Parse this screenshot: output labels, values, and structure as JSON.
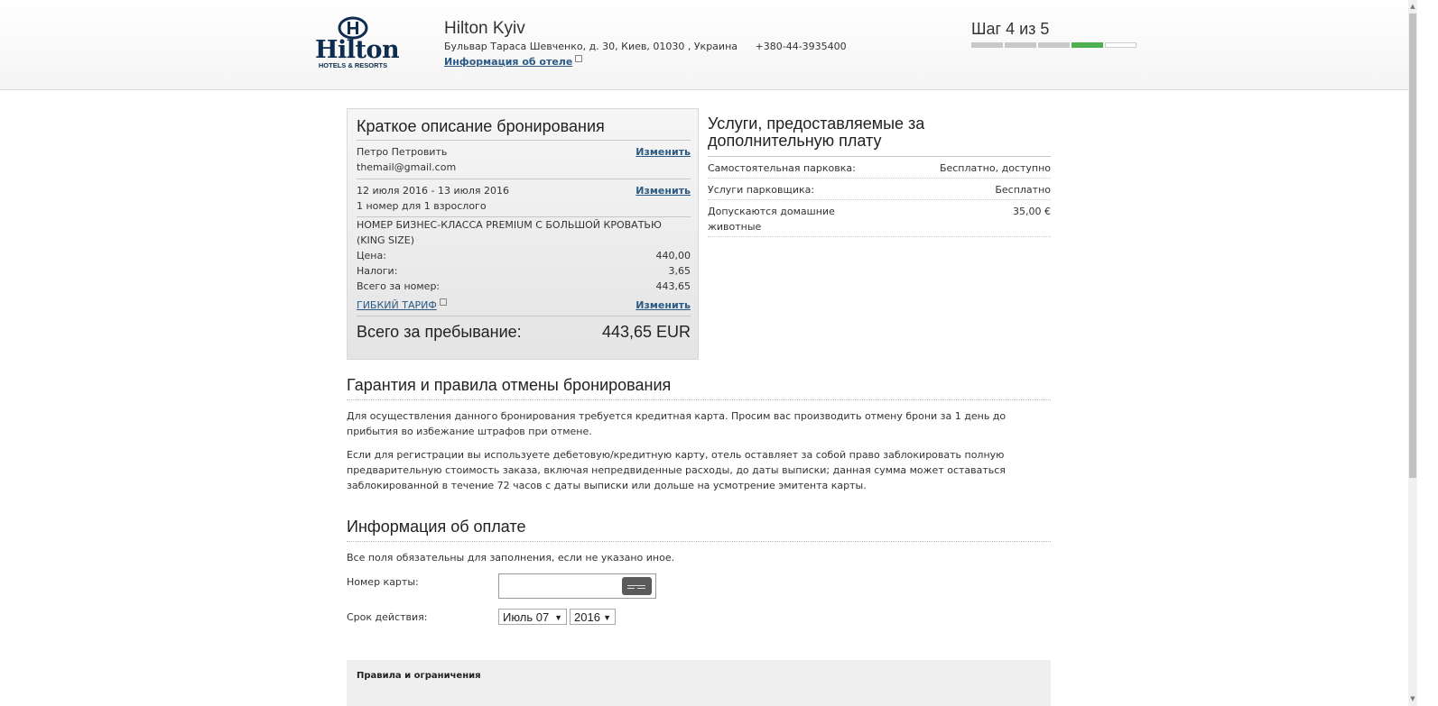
{
  "header": {
    "logo_name": "Hilton",
    "logo_sub": "HOTELS & RESORTS",
    "hotel_name": "Hilton Kyiv",
    "address": "Бульвар Тараса Шевченко, д. 30, Киев, 01030 , Украина",
    "phone": "+380-44-3935400",
    "hotel_info_link": "Информация об отеле",
    "step_label": "Шаг 4 из 5",
    "step_current": 4,
    "step_total": 5
  },
  "summary": {
    "title": "Краткое описание бронирования",
    "guest_name": "Петро Петровить",
    "guest_email": "themail@gmail.com",
    "dates": "12 июля 2016 - 13 июля 2016",
    "rooms": "1 номер для 1 взрослого",
    "room_type": "НОМЕР БИЗНЕС-КЛАССА PREMIUM С БОЛЬШОЙ КРОВАТЬЮ (KING SIZE)",
    "price_label": "Цена:",
    "price_value": "440,00",
    "taxes_label": "Налоги:",
    "taxes_value": "3,65",
    "room_total_label": "Всего за номер:",
    "room_total_value": "443,65",
    "tariff_link": "ГИБКИЙ ТАРИФ",
    "change_label": "Изменить",
    "stay_total_label": "Всего за пребывание:",
    "stay_total_value": "443,65 EUR"
  },
  "extras": {
    "title": "Услуги, предоставляемые за дополнительную плату",
    "items": [
      {
        "label": "Самостоятельная парковка:",
        "value": "Бесплатно, доступно"
      },
      {
        "label": "Услуги парковщика:",
        "value": "Бесплатно"
      },
      {
        "label": "Допускаются домашние животные",
        "value": "35,00 €"
      }
    ]
  },
  "guarantee": {
    "title": "Гарантия и правила отмены бронирования",
    "para1": "Для осуществления данного бронирования требуется кредитная карта. Просим вас производить отмену брони за 1 день до прибытия во избежание штрафов при отмене.",
    "para2": "Если для регистрации вы используете дебетовую/кредитную карту, отель оставляет за собой право заблокировать полную предварительную стоимость заказа, включая непредвиденные расходы, до даты выписки; данная сумма может оставаться заблокированной в течение 72 часов с даты выписки или дольше на усмотрение эмитента карты."
  },
  "payment": {
    "title": "Информация об оплате",
    "note": "Все поля обязательны для заполнения, если не указано иное.",
    "card_label": "Номер карты:",
    "card_value": "",
    "expiry_label": "Срок действия:",
    "month_selected": "Июль 07",
    "year_selected": "2016"
  },
  "rules": {
    "title": "Правила и ограничения"
  },
  "colors": {
    "link": "#2b5a84",
    "progress_current": "#4caf50",
    "brand": "#0e2c4e"
  }
}
